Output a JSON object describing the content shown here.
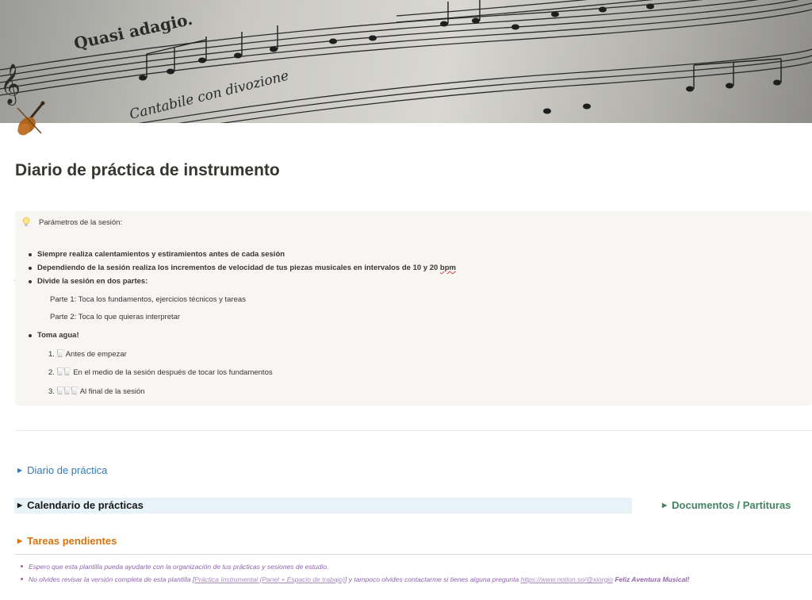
{
  "page": {
    "title": "Diario de práctica de instrumento",
    "cover_text_1": "Quasi adagio.",
    "cover_text_2": "Cantabile con divozione",
    "icon": "violin-icon"
  },
  "callout": {
    "icon": "lightbulb-icon",
    "heading": "Parámetros de la sesión:",
    "bullet_1": "Siempre realiza calentamientos y estiramientos antes de cada sesión",
    "bullet_2": "Dependiendo de la sesión realiza los incrementos de velocidad de tus piezas musicales en intervalos de 10 y 20 ",
    "bullet_2_unit": "bpm",
    "bullet_3": "Divide la sesión en dos partes:",
    "part_1": "Parte 1:  Toca los fundamentos, ejercicios técnicos y tareas",
    "part_2": "Parte 2: Toca lo que quieras interpretar",
    "bullet_4": "Toma agua!",
    "num_1_label": "1.",
    "num_1_text": "Antes de empezar",
    "num_2_label": "2.",
    "num_2_text": "En el medio de la sesión después de tocar los fundamentos",
    "num_3_label": "3.",
    "num_3_text": "Al final de la sesión"
  },
  "toggles": {
    "diario": "Diario de práctica",
    "calendario": "Calendario de prácticas",
    "documentos": "Documentos / Partituras",
    "tareas": "Tareas pendientes"
  },
  "footer": {
    "line_1": "Espero que esta plantilla pueda ayudarte con la organización de tus prácticas y sesiones de estudio.",
    "line_2_prefix": "No olvides revisar la versión completa de esta plantilla [",
    "line_2_link": "Práctica Instrumental (Panel + Espacio de trabajo)",
    "line_2_mid": "] y tampoco olvides contactarme si tienes alguna pregunta ",
    "line_2_url": "https://www.notion.so/@xiorgio",
    "line_2_end": "Feliz Aventura Musical!"
  },
  "colors": {
    "blue": "#2f7ab8",
    "green": "#448361",
    "orange": "#d9730d",
    "purple": "#9065b0",
    "callout_bg": "#f7f6f3",
    "calendar_bg": "#e7f3f8"
  }
}
